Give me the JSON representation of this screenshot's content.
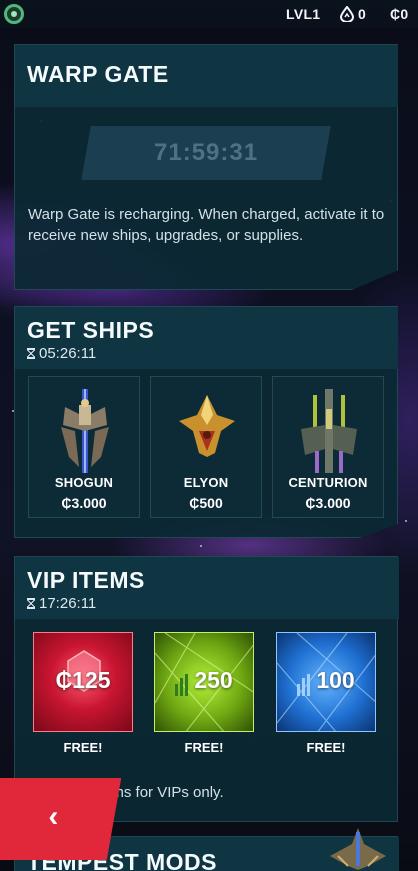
{
  "topbar": {
    "level": "LVL1",
    "fuel": "0",
    "credits": "₵0"
  },
  "warp_gate": {
    "title": "WARP GATE",
    "countdown": "71:59:31",
    "description": "Warp Gate is recharging. When charged, activate it to receive new ships, upgrades, or supplies."
  },
  "get_ships": {
    "title": "GET SHIPS",
    "timer": "05:26:11",
    "ships": [
      {
        "name": "SHOGUN",
        "price": "₵3.000"
      },
      {
        "name": "ELYON",
        "price": "₵500"
      },
      {
        "name": "CENTURION",
        "price": "₵3.000"
      }
    ]
  },
  "vip_items": {
    "title": "VIP ITEMS",
    "timer": "17:26:11",
    "items": [
      {
        "value": "₵125",
        "price": "FREE!",
        "color": "#e0203f"
      },
      {
        "value": "250",
        "price": "FREE!",
        "color": "#8fd61a"
      },
      {
        "value": "100",
        "price": "FREE!",
        "color": "#1f82e6"
      }
    ],
    "note": "Exclusive items for VIPs only."
  },
  "tempest_mods": {
    "title": "TEMPEST MODS"
  },
  "icons": {
    "logo": "game-logo-icon",
    "fuel": "fuel-drop-icon",
    "timer": "hourglass-icon",
    "back": "chevron-left-icon"
  },
  "colors": {
    "panel": "#0b2934",
    "back_button": "#e0283a"
  }
}
